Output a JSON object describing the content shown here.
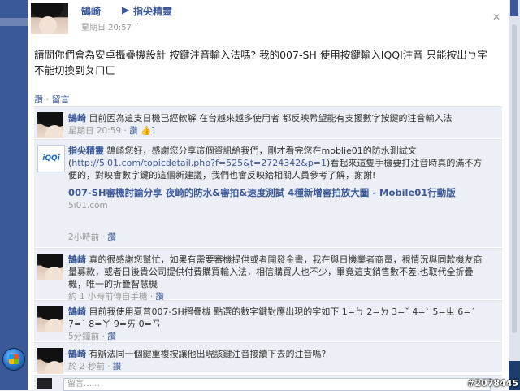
{
  "post": {
    "author": "鵠崎",
    "arrow": "▶",
    "target": "指尖精靈",
    "time": "星期日 20:57",
    "privacy": "·",
    "body": "請問你們會為安卓攝疊機設計 按鍵注音輸入法嗎? 我的007-SH 使用按鍵輸入IQQI注音 只能按出ㄅ字 不能切換到ㄆㄇㄈ",
    "actions": {
      "like": "讚",
      "sep": "·",
      "comment": "留言"
    }
  },
  "comments": [
    {
      "author": "鵠崎",
      "text": "目前因為這支日機已經軟解 在台越來越多使用者 都反映希望能有支援數字按鍵的注音輸入法",
      "meta": "星期日 20:59",
      "meta_sep": " · ",
      "like": "讚",
      "like_count": "1"
    },
    {
      "author": "指尖精靈",
      "logo": "iQQi",
      "text": "鵠崎您好，感謝您分享這個資訊給我們，剛才看完您在moblie01的防水測試文(",
      "link": "http://5i01.com/topicdetail.php?f=525&t=2724342&p=1",
      "text2": ")看起來這隻手機要打注音時真的滿不方便的，對映會數字鍵的這個新建議，我們也會反映給相關人員參考了解，謝謝!",
      "share_title": "007-SH審機討論分享 夜崎的防水&審拍&速度測試 4種新增審拍放大圖 - Mobile01行動版",
      "share_domain": "5i01.com",
      "meta": "2小時前",
      "meta_sep": " · ",
      "like": "讚"
    },
    {
      "author": "鵠崎",
      "text": "真的很感謝您幫忙，如果有需要審機提供或者開發金書，我在與日機業者商量，視情況與同款機友商量募款，或者日後貴公司提供付費購買輸入法，相信購買人也不少，畢竟這支銷售數不差,也取代全折疊機，唯一的折疊智慧機",
      "meta": "約 1 小時前傳自手機",
      "meta_sep": " · ",
      "like": "讚"
    },
    {
      "author": "鵠崎",
      "text": "目前我使用夏普007-SH摺疊機 點選的數字鍵對應出現的字如下 1=ㄅ 2=ㄉ 3=ˇ 4=ˋ 5=ㄓ 6=ˊ 7=˙ 8=ㄚ 9=ㄞ 0=ㄢ",
      "meta": "5分鐘前",
      "meta_sep": " · ",
      "like": "讚"
    },
    {
      "author": "鵠崎",
      "text": "有辦法同一個鍵重複按讓他出現該鍵注音接續下去的注音嗎?",
      "meta": "於 2 秒前",
      "meta_sep": " · ",
      "like": "讚"
    }
  ],
  "reply": {
    "placeholder": "留言……"
  },
  "watermark": "#2078445"
}
